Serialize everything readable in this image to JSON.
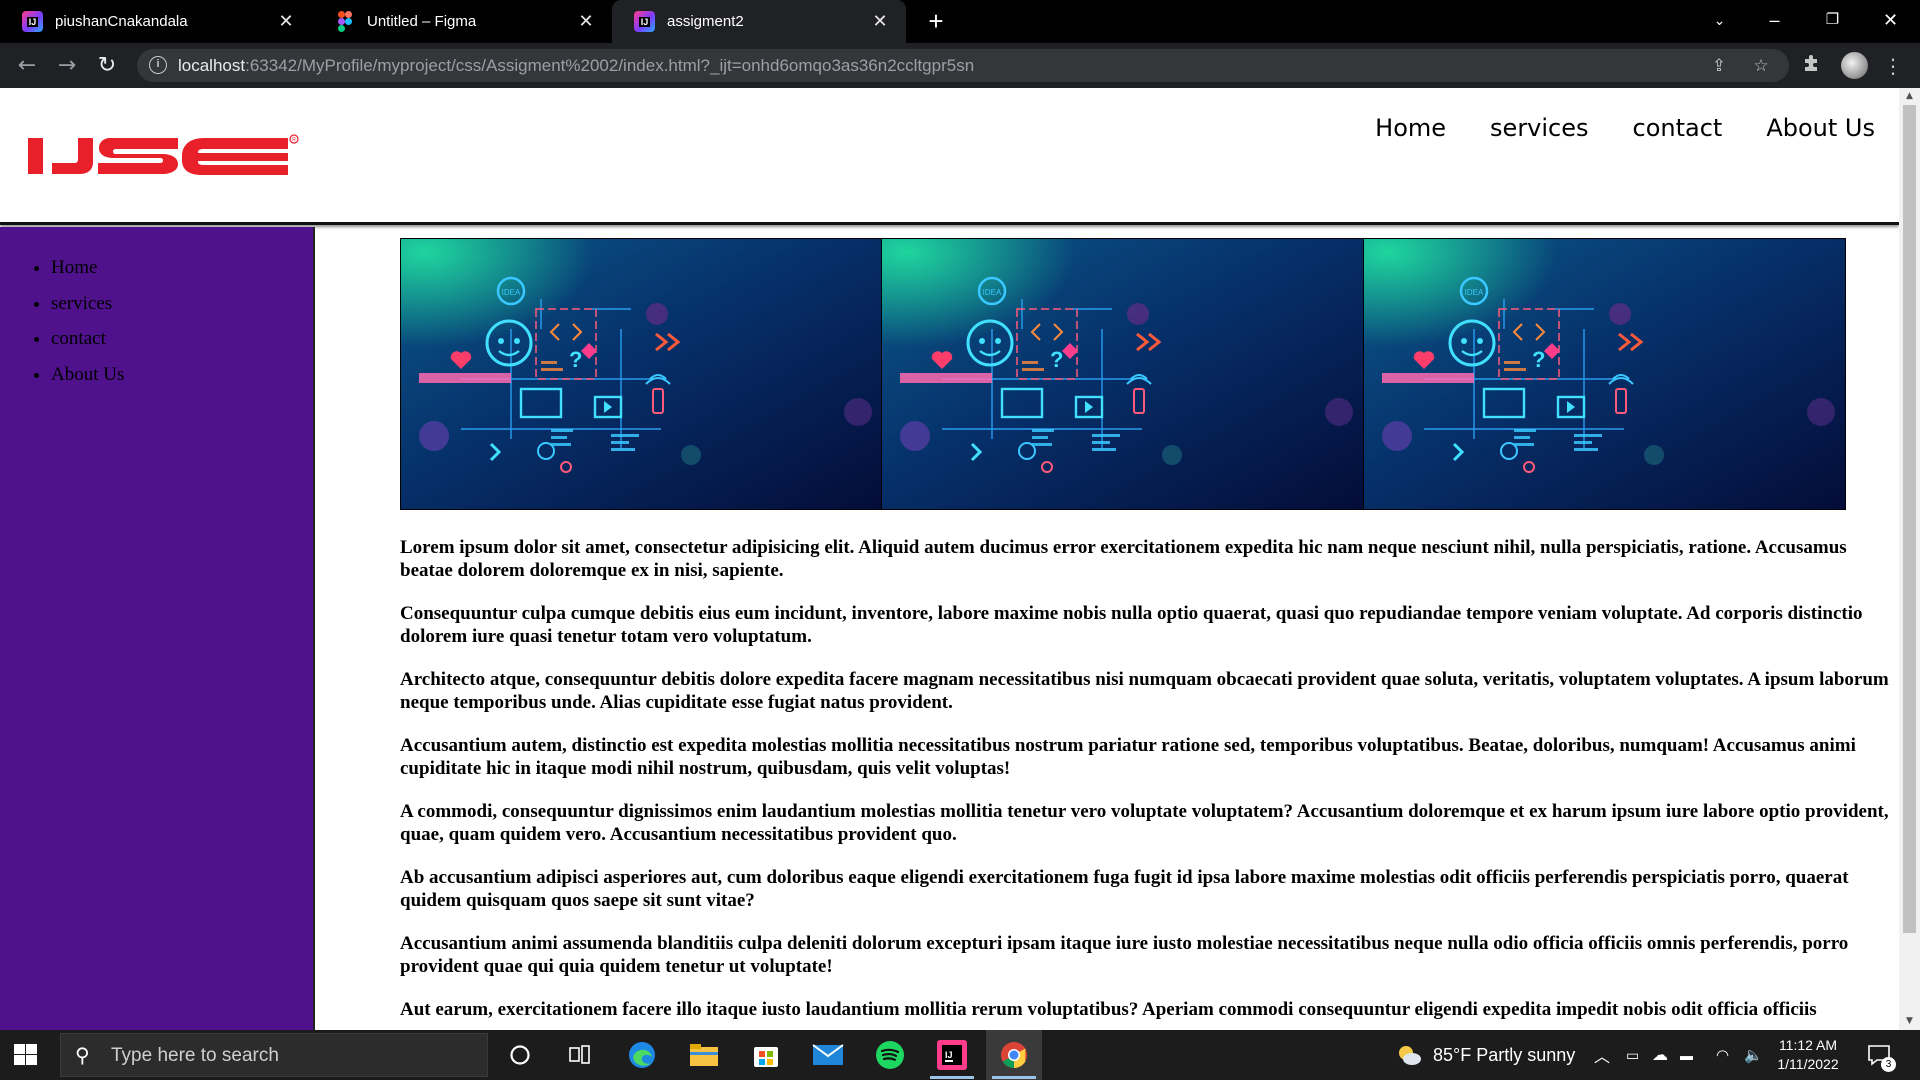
{
  "browser": {
    "tabs": [
      {
        "title": "piushanCnakandala",
        "icon": "intellij-icon",
        "active": false
      },
      {
        "title": "Untitled – Figma",
        "icon": "figma-icon",
        "active": false
      },
      {
        "title": "assigment2",
        "icon": "intellij-icon",
        "active": true
      }
    ],
    "url_host": "localhost",
    "url_path": ":63342/MyProfile/myproject/css/Assigment%2002/index.html?_ijt=onhd6omqo3as36n2ccltgpr5sn"
  },
  "site": {
    "logo_text": "IJSE",
    "nav": [
      "Home",
      "services",
      "contact",
      "About Us"
    ],
    "sidebar": [
      "Home",
      "services",
      "contact",
      "About Us"
    ],
    "paragraphs": [
      "Lorem ipsum dolor sit amet, consectetur adipisicing elit. Aliquid autem ducimus error exercitationem expedita hic nam neque nesciunt nihil, nulla perspiciatis, ratione. Accusamus beatae dolorem doloremque ex in nisi, sapiente.",
      "Consequuntur culpa cumque debitis eius eum incidunt, inventore, labore maxime nobis nulla optio quaerat, quasi quo repudiandae tempore veniam voluptate. Ad corporis distinctio dolorem iure quasi tenetur totam vero voluptatum.",
      "Architecto atque, consequuntur debitis dolore expedita facere magnam necessitatibus nisi numquam obcaecati provident quae soluta, veritatis, voluptatem voluptates. A ipsum laborum neque temporibus unde. Alias cupiditate esse fugiat natus provident.",
      "Accusantium autem, distinctio est expedita molestias mollitia necessitatibus nostrum pariatur ratione sed, temporibus voluptatibus. Beatae, doloribus, numquam! Accusamus animi cupiditate hic in itaque modi nihil nostrum, quibusdam, quis velit voluptas!",
      "A commodi, consequuntur dignissimos enim laudantium molestias mollitia tenetur vero voluptate voluptatem? Accusantium doloremque et ex harum ipsum iure labore optio provident, quae, quam quidem vero. Accusantium necessitatibus provident quo.",
      "Ab accusantium adipisci asperiores aut, cum doloribus eaque eligendi exercitationem fuga fugit id ipsa labore maxime molestias odit officiis perferendis perspiciatis porro, quaerat quidem quisquam quos saepe sit sunt vitae?",
      "Accusantium animi assumenda blanditiis culpa deleniti dolorum excepturi ipsam itaque iure iusto molestiae necessitatibus neque nulla odio officia officiis omnis perferendis, porro provident quae qui quia quidem tenetur ut voluptate!",
      "Aut earum, exercitationem facere illo itaque iusto laudantium mollitia rerum voluptatibus? Aperiam commodi consequuntur eligendi expedita impedit nobis odit officia officiis"
    ],
    "colors": {
      "sidebar": "#4f128c",
      "logo_red": "#e8202a"
    }
  },
  "taskbar": {
    "search_placeholder": "Type here to search",
    "weather": "85°F  Partly sunny",
    "time": "11:12 AM",
    "date": "1/11/2022",
    "notifications": "3"
  }
}
